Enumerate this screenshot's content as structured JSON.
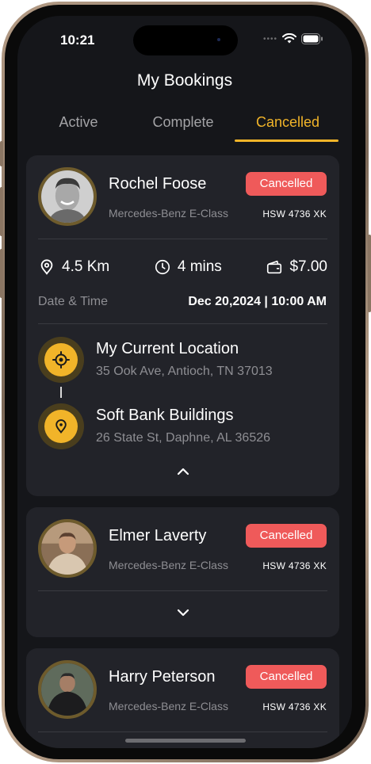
{
  "status_bar": {
    "time": "10:21"
  },
  "header": {
    "title": "My Bookings"
  },
  "tabs": [
    {
      "label": "Active"
    },
    {
      "label": "Complete"
    },
    {
      "label": "Cancelled"
    }
  ],
  "bookings": [
    {
      "name": "Rochel Foose",
      "status": "Cancelled",
      "car": "Mercedes-Benz E-Class",
      "plate": "HSW 4736 XK",
      "distance": "4.5 Km",
      "duration": "4 mins",
      "price": "$7.00",
      "datetime_label": "Date & Time",
      "datetime_value": "Dec 20,2024 | 10:00 AM",
      "pickup_title": "My Current Location",
      "pickup_address": "35 Ook Ave, Antioch, TN 37013",
      "dropoff_title": "Soft Bank Buildings",
      "dropoff_address": "26 State St, Daphne, AL 36526"
    },
    {
      "name": "Elmer Laverty",
      "status": "Cancelled",
      "car": "Mercedes-Benz E-Class",
      "plate": "HSW 4736 XK"
    },
    {
      "name": "Harry Peterson",
      "status": "Cancelled",
      "car": "Mercedes-Benz E-Class",
      "plate": "HSW 4736 XK"
    }
  ],
  "colors": {
    "accent": "#f1b429",
    "badge": "#ef5a5a",
    "card": "#222329",
    "background": "#15161a"
  }
}
